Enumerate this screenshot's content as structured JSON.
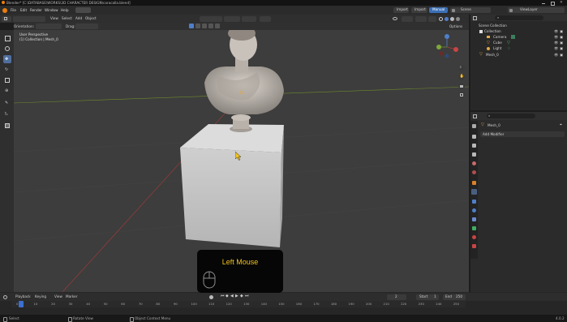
{
  "title_bar": {
    "text": "Blender* [C:\\DATABASE\\WORKS\\3D CHARACTER DESIGN\\caracalla.blend]"
  },
  "top_menu": {
    "items": [
      "File",
      "Edit",
      "Render",
      "Window",
      "Help"
    ],
    "workspaces": [
      "Layout",
      "Modeling",
      "Sculpting",
      "UV Editing",
      "Texture Paint",
      "Shading",
      "Animation",
      "Rendering",
      "Compositing",
      "Geometry Nodes",
      "Scripting"
    ],
    "active_workspace": "Layout",
    "right_buttons": [
      "Import",
      "Import",
      "Manual"
    ],
    "scene_label": "Scene",
    "viewlayer_label": "ViewLayer"
  },
  "viewport_header": {
    "mode": "Object Mode",
    "menus": [
      "View",
      "Select",
      "Add",
      "Object"
    ],
    "orientation_label": "Orientation:",
    "orientation_value": "Default",
    "drag_label": "Drag:",
    "drag_value": "Select Box",
    "transform_orientation": "Global",
    "options_label": "Options"
  },
  "viewport": {
    "perspective_label": "User Perspective",
    "collection_label": "(1) Collection | Mesh_0"
  },
  "outliner": {
    "root": "Scene Collection",
    "collection": "Collection",
    "items": [
      "Camera",
      "Cube",
      "Light"
    ],
    "mesh": "Mesh_0"
  },
  "properties": {
    "object_name": "Mesh_0",
    "add_modifier": "Add Modifier"
  },
  "timeline": {
    "menus": [
      "Playback",
      "Keying",
      "View",
      "Marker"
    ],
    "current_frame": "2",
    "start_label": "Start",
    "start_value": "1",
    "end_label": "End",
    "end_value": "250",
    "ticks": [
      "0",
      "10",
      "20",
      "30",
      "40",
      "50",
      "60",
      "70",
      "80",
      "90",
      "100",
      "110",
      "120",
      "130",
      "140",
      "150",
      "160",
      "170",
      "180",
      "190",
      "200",
      "210",
      "220",
      "230",
      "240",
      "250"
    ],
    "playhead_frame": 2
  },
  "status_bar": {
    "items": [
      "Select",
      "Rotate View",
      "Object Context Menu"
    ],
    "version": "4.0.2"
  },
  "overlay": {
    "label": "Left Mouse"
  },
  "colors": {
    "accent_blue": "#4f7fc9",
    "playhead_blue": "#3d6fd1",
    "overlay_text": "#f2c21f",
    "axis_red": "#a83a3a",
    "axis_green": "#6c8a2c"
  }
}
